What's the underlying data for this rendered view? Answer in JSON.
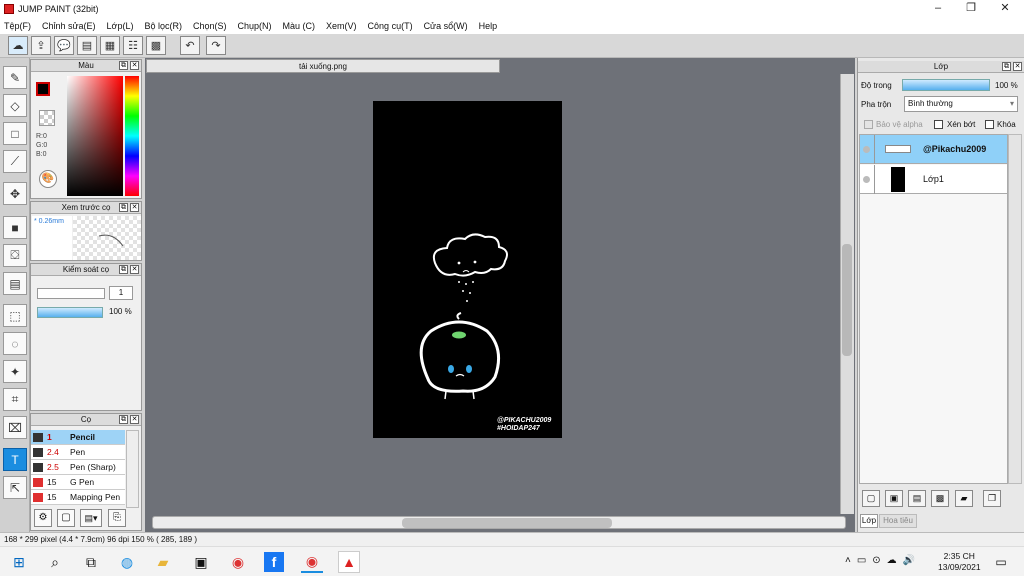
{
  "window": {
    "title": "JUMP PAINT (32bit)",
    "minimize": "–",
    "maximize": "❐",
    "close": "✕"
  },
  "menu": [
    "Tệp(F)",
    "Chỉnh sửa(E)",
    "Lớp(L)",
    "Bộ lọc(R)",
    "Chọn(S)",
    "Chụp(N)",
    "Màu (C)",
    "Xem(V)",
    "Công cụ(T)",
    "Cửa sổ(W)",
    "Help"
  ],
  "panels": {
    "color": {
      "title": "Màu",
      "r": "R:0",
      "g": "G:0",
      "b": "B:0"
    },
    "preview": {
      "title": "Xem trước cọ",
      "size": "* 0.26mm"
    },
    "brushctrl": {
      "title": "Kiểm soát cọ",
      "value": "1",
      "opacity": "100 %"
    },
    "brush": {
      "title": "Cọ",
      "items": [
        {
          "size": "1",
          "name": "Pencil",
          "color": "#333333"
        },
        {
          "size": "2.4",
          "name": "Pen",
          "color": "#333333"
        },
        {
          "size": "2.5",
          "name": "Pen (Sharp)",
          "color": "#333333"
        },
        {
          "size": "15",
          "name": "G Pen",
          "color": "#e03030"
        },
        {
          "size": "15",
          "name": "Mapping Pen",
          "color": "#e03030"
        }
      ]
    }
  },
  "document": {
    "tab": "tải xuống.png",
    "watermark1": "@PIKACHU2009",
    "watermark2": "#HOIDAP247"
  },
  "layers": {
    "title": "Lớp",
    "opacity_label": "Độ trong",
    "opacity_value": "100 %",
    "blend_label": "Pha trộn",
    "blend_value": "Bình thường",
    "protect_alpha": "Bảo vệ alpha",
    "clip": "Xén bớt",
    "lock": "Khóa",
    "items": [
      {
        "name": "@Pikachu2009"
      },
      {
        "name": "Lớp1"
      }
    ],
    "tab1": "Lớp",
    "tab2": "Hoa tiêu"
  },
  "status": {
    "text": "168 * 299 pixel  (4.4 * 7.9cm)  96 dpi  150 %  ( 285, 189 )"
  },
  "taskbar": {
    "time": "2:35 CH",
    "date": "13/09/2021"
  }
}
